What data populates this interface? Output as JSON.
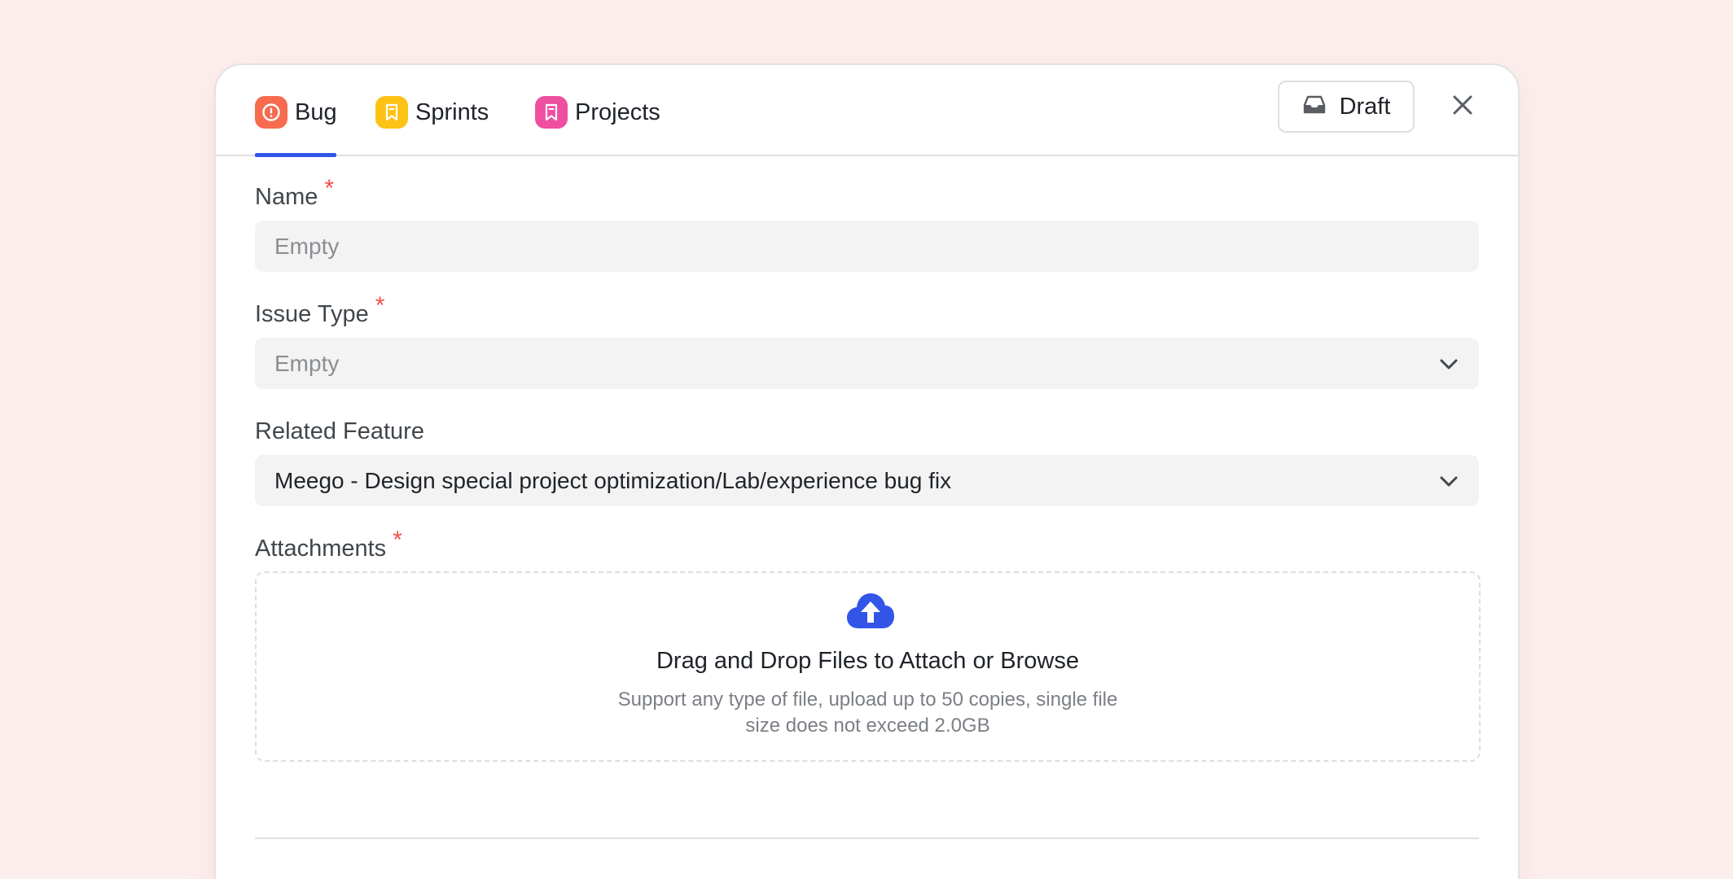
{
  "tabs": [
    {
      "label": "Bug",
      "icon": "alert-circle-icon",
      "color": "#f76b4f",
      "active": true
    },
    {
      "label": "Sprints",
      "icon": "bookmark-icon",
      "color": "#fcc216",
      "active": false
    },
    {
      "label": "Projects",
      "icon": "bookmark-icon",
      "color": "#ee4fa0",
      "active": false
    }
  ],
  "toolbar": {
    "draft_label": "Draft",
    "draft_icon": "inbox-icon",
    "close_icon": "close-icon"
  },
  "form": {
    "name": {
      "label": "Name",
      "required_mark": "*",
      "placeholder": "Empty"
    },
    "issue_type": {
      "label": "Issue Type",
      "required_mark": "*",
      "placeholder": "Empty"
    },
    "related_feature": {
      "label": "Related Feature",
      "value": "Meego - Design special project optimization/Lab/experience bug fix"
    },
    "attachments": {
      "label": "Attachments",
      "required_mark": "*",
      "title": "Drag and Drop Files to Attach or Browse",
      "subtitle_line1": "Support any type of file, upload up to 50 copies, single file",
      "subtitle_line2": "size does not exceed 2.0GB"
    }
  },
  "colors": {
    "accent": "#3255e8",
    "required": "#f0524a",
    "background": "#fdeeee"
  }
}
